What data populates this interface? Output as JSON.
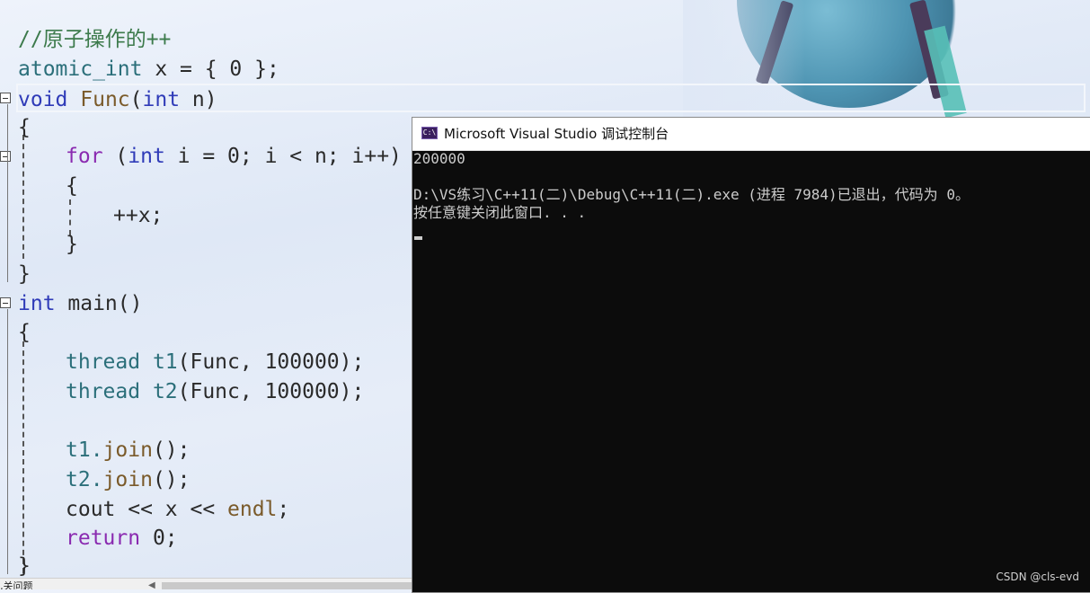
{
  "editor": {
    "lines": {
      "l1": "//原子操作的++",
      "l2_type": "atomic_int",
      "l2_rest": " x = { 0 };",
      "l3_void": "void",
      "l3_fn": "Func",
      "l3_paren": "(",
      "l3_int": "int",
      "l3_param": "n",
      "l3_close": ")",
      "l4": "{",
      "l5_for": "for",
      "l5_open": " (",
      "l5_int": "int",
      "l5_rest": " i = 0; i < n; i++)",
      "l6": "{",
      "l7": "++x;",
      "l8": "}",
      "l9": "}",
      "l10_int": "int",
      "l10_main": " main()",
      "l11": "{",
      "l12_type": "thread",
      "l12_var": " t1",
      "l12_rest": "(Func, 100000);",
      "l13_type": "thread",
      "l13_var": " t2",
      "l13_rest": "(Func, 100000);",
      "l15_obj": "t1.",
      "l15_fn": "join",
      "l15_rest": "();",
      "l16_obj": "t2.",
      "l16_fn": "join",
      "l16_rest": "();",
      "l17_cout": "cout",
      "l17_rest": " << x << ",
      "l17_endl": "endl",
      "l17_semi": ";",
      "l18_ret": "return",
      "l18_rest": " 0;",
      "l19": "}"
    }
  },
  "bottom_panel": {
    "label": "‚关问题"
  },
  "console": {
    "title": "Microsoft Visual Studio 调试控制台",
    "icon_text": "C:\\",
    "output_lines": [
      "200000",
      "",
      "D:\\VS练习\\C++11(二)\\Debug\\C++11(二).exe (进程 7984)已退出，代码为 0。",
      "按任意键关闭此窗口. . ."
    ]
  },
  "watermark": "CSDN @cls-evd",
  "colors": {
    "keyword": "#2f3bb8",
    "control_keyword": "#8a2ab0",
    "type": "#2b6f7a",
    "function": "#7a5a2a",
    "console_bg": "#0c0c0c",
    "console_text": "#cccccc"
  },
  "icons": {
    "console_app_icon": "console-icon",
    "fold_toggle": "collapse-minus-icon"
  }
}
